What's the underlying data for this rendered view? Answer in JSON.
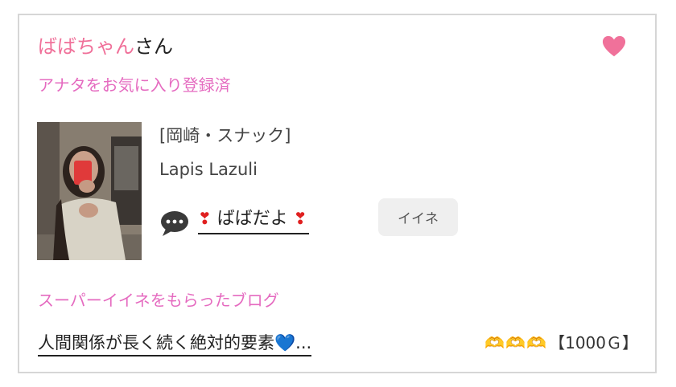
{
  "user": {
    "name": "ばばちゃん",
    "suffix": "さん",
    "favorite_status": "アナタをお気に入り登録済"
  },
  "shop": {
    "category": "[岡崎・スナック]",
    "name": "Lapis Lazuli"
  },
  "message": {
    "heart_left": "❣",
    "text": "ばばだよ",
    "heart_right": "❣"
  },
  "like_button": {
    "label": "イイネ"
  },
  "blog": {
    "heading": "スーパーイイネをもらったブログ",
    "title": "人間関係が長く続く絶対的要素",
    "title_emoji": "💙",
    "ellipsis": "...",
    "reward_icons": "🫶🫶🫶",
    "reward": "【1000Ｇ】"
  },
  "colors": {
    "accent_pink": "#f0719a",
    "label_pink": "#e56bc0",
    "heart": "#f0719a"
  },
  "icons": {
    "favorite": "heart-icon",
    "message": "speech-bubble-icon"
  }
}
